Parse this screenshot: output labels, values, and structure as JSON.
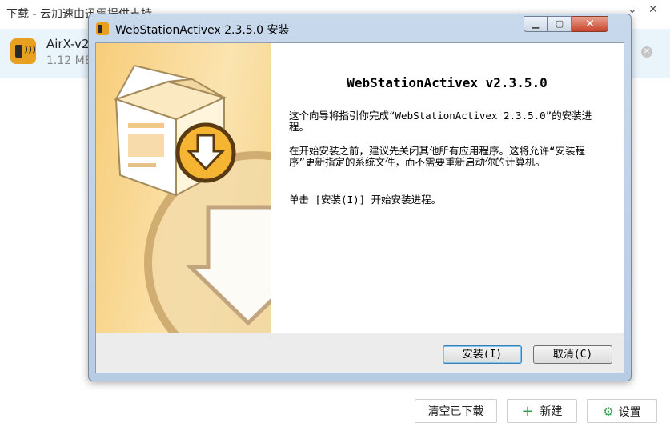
{
  "background_app": {
    "title": "下载 - 云加速由迅雷提供支持",
    "file": {
      "name": "AirX-v2",
      "size": "1.12 MB"
    },
    "footer": {
      "clear_label": "清空已下载",
      "new_label": "新建",
      "settings_label": "设置"
    },
    "colors": {
      "accent": "#2aa34a",
      "row_highlight": "#e9f4fb"
    }
  },
  "installer": {
    "window_title": "WebStationActivex 2.3.5.0 安装",
    "heading": "WebStationActivex v2.3.5.0",
    "para1": "这个向导将指引你完成“WebStationActivex 2.3.5.0”的安装进程。",
    "para2": "在开始安装之前，建议先关闭其他所有应用程序。这将允许“安装程序”更新指定的系统文件，而不需要重新启动你的计算机。",
    "para3": "单击 [安装(I)] 开始安装进程。",
    "install_label": "安装(I)",
    "cancel_label": "取消(C)",
    "colors": {
      "banner": "#f7cd7a",
      "close": "#c8442a"
    }
  }
}
